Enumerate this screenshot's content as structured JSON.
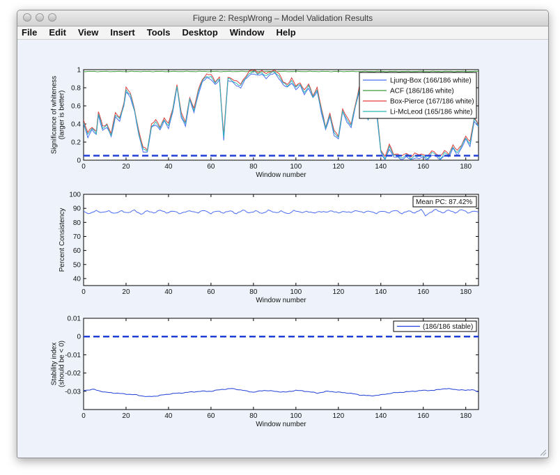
{
  "window": {
    "title": "Figure 2: RespWrong – Model Validation Results"
  },
  "menu": [
    "File",
    "Edit",
    "View",
    "Insert",
    "Tools",
    "Desktop",
    "Window",
    "Help"
  ],
  "colors": {
    "blue": "#4a6cf0",
    "green": "#3c9a3c",
    "red": "#e03a3a",
    "cyan": "#2ab7b7",
    "dashed": "#1f3fd6",
    "background": "#eef3fb"
  },
  "chart_data": [
    {
      "type": "line",
      "xlabel": "Window number",
      "ylabel": [
        "Significance of whiteness",
        "(larger is better)"
      ],
      "xlim": [
        0,
        186
      ],
      "ylim": [
        0,
        1
      ],
      "xticks": [
        0,
        20,
        40,
        60,
        80,
        100,
        120,
        140,
        160,
        180
      ],
      "yticks": [
        0,
        0.2,
        0.4,
        0.6,
        0.8,
        1
      ],
      "ytick_labels": [
        "0",
        "0.2",
        "0.4",
        "0.6",
        "0.8",
        "1"
      ],
      "legend_position": "top-right",
      "series": [
        {
          "name": "Ljung-Box (166/186 white)",
          "color": "#4a6cf0",
          "offset": -0.02
        },
        {
          "name": "ACF (186/186 white)",
          "color": "#3c9a3c",
          "constant": 0.98
        },
        {
          "name": "Box-Pierce (167/186 white)",
          "color": "#e03a3a",
          "offset": 0.02
        },
        {
          "name": "Li-McLeod (165/186 white)",
          "color": "#2ab7b7",
          "offset": 0.0
        }
      ],
      "base_keypoints": [
        [
          0,
          0.42
        ],
        [
          2,
          0.28
        ],
        [
          4,
          0.35
        ],
        [
          6,
          0.3
        ],
        [
          7,
          0.52
        ],
        [
          9,
          0.35
        ],
        [
          11,
          0.38
        ],
        [
          13,
          0.28
        ],
        [
          15,
          0.5
        ],
        [
          17,
          0.45
        ],
        [
          19,
          0.62
        ],
        [
          20,
          0.78
        ],
        [
          22,
          0.72
        ],
        [
          24,
          0.55
        ],
        [
          26,
          0.3
        ],
        [
          28,
          0.12
        ],
        [
          30,
          0.1
        ],
        [
          32,
          0.38
        ],
        [
          34,
          0.42
        ],
        [
          36,
          0.35
        ],
        [
          38,
          0.45
        ],
        [
          40,
          0.38
        ],
        [
          42,
          0.55
        ],
        [
          44,
          0.82
        ],
        [
          46,
          0.5
        ],
        [
          48,
          0.4
        ],
        [
          50,
          0.68
        ],
        [
          52,
          0.55
        ],
        [
          54,
          0.75
        ],
        [
          56,
          0.88
        ],
        [
          58,
          0.93
        ],
        [
          60,
          0.92
        ],
        [
          62,
          0.85
        ],
        [
          64,
          0.9
        ],
        [
          66,
          0.25
        ],
        [
          68,
          0.9
        ],
        [
          70,
          0.88
        ],
        [
          72,
          0.85
        ],
        [
          74,
          0.82
        ],
        [
          76,
          0.9
        ],
        [
          78,
          0.96
        ],
        [
          80,
          0.98
        ],
        [
          82,
          0.95
        ],
        [
          84,
          0.97
        ],
        [
          86,
          0.93
        ],
        [
          88,
          0.96
        ],
        [
          90,
          0.98
        ],
        [
          92,
          0.93
        ],
        [
          94,
          0.85
        ],
        [
          96,
          0.82
        ],
        [
          98,
          0.88
        ],
        [
          100,
          0.8
        ],
        [
          102,
          0.84
        ],
        [
          104,
          0.75
        ],
        [
          106,
          0.82
        ],
        [
          108,
          0.7
        ],
        [
          110,
          0.78
        ],
        [
          112,
          0.55
        ],
        [
          114,
          0.35
        ],
        [
          116,
          0.5
        ],
        [
          118,
          0.3
        ],
        [
          120,
          0.25
        ],
        [
          122,
          0.55
        ],
        [
          124,
          0.45
        ],
        [
          126,
          0.38
        ],
        [
          128,
          0.6
        ],
        [
          130,
          0.8
        ],
        [
          132,
          0.65
        ],
        [
          134,
          0.45
        ],
        [
          136,
          0.72
        ],
        [
          138,
          0.55
        ],
        [
          140,
          0.1
        ],
        [
          142,
          0.02
        ],
        [
          144,
          0.15
        ],
        [
          146,
          0.05
        ],
        [
          148,
          0.05
        ],
        [
          150,
          0.02
        ],
        [
          152,
          0.06
        ],
        [
          154,
          0.02
        ],
        [
          156,
          0.05
        ],
        [
          158,
          0.04
        ],
        [
          160,
          0.05
        ],
        [
          162,
          0.02
        ],
        [
          164,
          0.08
        ],
        [
          166,
          0.06
        ],
        [
          168,
          0.02
        ],
        [
          170,
          0.08
        ],
        [
          172,
          0.05
        ],
        [
          174,
          0.15
        ],
        [
          176,
          0.08
        ],
        [
          178,
          0.15
        ],
        [
          180,
          0.25
        ],
        [
          182,
          0.18
        ],
        [
          184,
          0.45
        ],
        [
          186,
          0.38
        ]
      ],
      "threshold": 0.05
    },
    {
      "type": "line",
      "xlabel": "Window number",
      "ylabel": [
        "Percent Consistency"
      ],
      "xlim": [
        0,
        186
      ],
      "ylim": [
        35,
        100
      ],
      "xticks": [
        0,
        20,
        40,
        60,
        80,
        100,
        120,
        140,
        160,
        180
      ],
      "yticks": [
        40,
        50,
        60,
        70,
        80,
        90,
        100
      ],
      "ytick_labels": [
        "40",
        "50",
        "60",
        "70",
        "80",
        "90",
        "100"
      ],
      "annotation": "Mean PC: 87.42%",
      "series": [
        {
          "name": "",
          "color": "#4a6cf0"
        }
      ],
      "base_keypoints": [
        [
          0,
          88
        ],
        [
          3,
          86
        ],
        [
          6,
          88.5
        ],
        [
          9,
          87
        ],
        [
          12,
          88
        ],
        [
          15,
          86.5
        ],
        [
          18,
          88
        ],
        [
          21,
          87
        ],
        [
          24,
          88.5
        ],
        [
          27,
          86
        ],
        [
          30,
          88
        ],
        [
          33,
          87
        ],
        [
          36,
          88.5
        ],
        [
          39,
          87
        ],
        [
          42,
          88
        ],
        [
          45,
          86.5
        ],
        [
          48,
          87.5
        ],
        [
          51,
          88
        ],
        [
          54,
          87
        ],
        [
          57,
          88.5
        ],
        [
          60,
          86.5
        ],
        [
          63,
          88
        ],
        [
          66,
          87
        ],
        [
          69,
          88
        ],
        [
          72,
          86.5
        ],
        [
          75,
          88.5
        ],
        [
          78,
          87
        ],
        [
          81,
          88
        ],
        [
          84,
          86.5
        ],
        [
          87,
          88.5
        ],
        [
          90,
          87
        ],
        [
          93,
          88
        ],
        [
          96,
          86
        ],
        [
          99,
          88.5
        ],
        [
          102,
          87
        ],
        [
          105,
          88
        ],
        [
          108,
          86.5
        ],
        [
          111,
          88
        ],
        [
          114,
          87
        ],
        [
          117,
          88.5
        ],
        [
          120,
          86.5
        ],
        [
          123,
          88
        ],
        [
          126,
          87
        ],
        [
          129,
          88.5
        ],
        [
          132,
          87
        ],
        [
          135,
          88
        ],
        [
          138,
          86.5
        ],
        [
          141,
          88
        ],
        [
          144,
          87
        ],
        [
          147,
          88.5
        ],
        [
          150,
          86.5
        ],
        [
          153,
          88
        ],
        [
          156,
          87
        ],
        [
          159,
          89
        ],
        [
          161,
          85
        ],
        [
          163,
          87
        ],
        [
          166,
          89
        ],
        [
          169,
          87
        ],
        [
          172,
          88.5
        ],
        [
          175,
          87
        ],
        [
          178,
          89
        ],
        [
          181,
          87
        ],
        [
          184,
          88
        ],
        [
          186,
          87
        ]
      ]
    },
    {
      "type": "line",
      "xlabel": "Window number",
      "ylabel": [
        "Stability index",
        "(should be < 0)"
      ],
      "xlim": [
        0,
        186
      ],
      "ylim": [
        -0.04,
        0.01
      ],
      "xticks": [
        0,
        20,
        40,
        60,
        80,
        100,
        120,
        140,
        160,
        180
      ],
      "yticks": [
        -0.03,
        -0.02,
        -0.01,
        0,
        0.01
      ],
      "ytick_labels": [
        "-0.03",
        "-0.02",
        "-0.01",
        "0",
        "0.01"
      ],
      "legend_position": "top-right",
      "series": [
        {
          "name": "(186/186 stable)",
          "color": "#1f3fd6"
        }
      ],
      "base_keypoints": [
        [
          0,
          -0.0295
        ],
        [
          5,
          -0.029
        ],
        [
          10,
          -0.0305
        ],
        [
          15,
          -0.031
        ],
        [
          20,
          -0.0315
        ],
        [
          25,
          -0.032
        ],
        [
          30,
          -0.033
        ],
        [
          35,
          -0.0325
        ],
        [
          40,
          -0.0315
        ],
        [
          45,
          -0.031
        ],
        [
          50,
          -0.0305
        ],
        [
          55,
          -0.03
        ],
        [
          60,
          -0.03
        ],
        [
          65,
          -0.029
        ],
        [
          70,
          -0.0285
        ],
        [
          75,
          -0.0295
        ],
        [
          80,
          -0.0305
        ],
        [
          85,
          -0.0295
        ],
        [
          90,
          -0.03
        ],
        [
          95,
          -0.0305
        ],
        [
          100,
          -0.0295
        ],
        [
          105,
          -0.03
        ],
        [
          110,
          -0.031
        ],
        [
          115,
          -0.03
        ],
        [
          120,
          -0.0305
        ],
        [
          125,
          -0.031
        ],
        [
          130,
          -0.032
        ],
        [
          135,
          -0.0325
        ],
        [
          140,
          -0.032
        ],
        [
          145,
          -0.031
        ],
        [
          150,
          -0.0305
        ],
        [
          155,
          -0.03
        ],
        [
          160,
          -0.0295
        ],
        [
          165,
          -0.0295
        ],
        [
          170,
          -0.0285
        ],
        [
          175,
          -0.029
        ],
        [
          180,
          -0.0295
        ],
        [
          183,
          -0.029
        ],
        [
          186,
          -0.0305
        ]
      ],
      "threshold": 0
    }
  ]
}
